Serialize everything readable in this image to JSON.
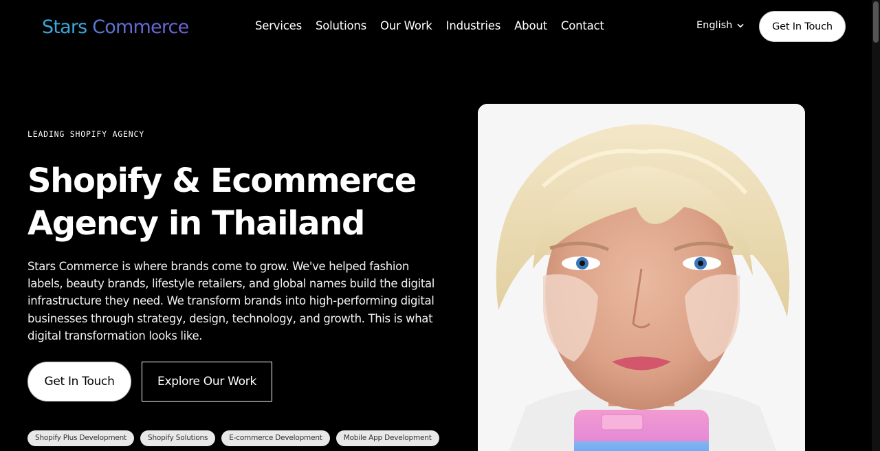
{
  "header": {
    "logo_part1": "Stars",
    "logo_part2": "Commerce",
    "nav": [
      "Services",
      "Solutions",
      "Our Work",
      "Industries",
      "About",
      "Contact"
    ],
    "language": "English",
    "cta": "Get In Touch"
  },
  "hero": {
    "eyebrow": "LEADING SHOPIFY AGENCY",
    "title_line1": "Shopify & Ecommerce",
    "title_line2": "Agency in Thailand",
    "description": "Stars Commerce is where brands come to grow. We've helped fashion labels, beauty brands, lifestyle retailers, and global names build the digital infrastructure they need. We transform brands into high-performing digital businesses through strategy, design, technology, and growth. This is what digital transformation looks like.",
    "primary_cta": "Get In Touch",
    "secondary_cta": "Explore Our Work",
    "tags": [
      "Shopify Plus Development",
      "Shopify Solutions",
      "E-commerce Development",
      "Mobile App Development"
    ]
  },
  "colors": {
    "background": "#000000",
    "logo_blue": "#3aa6d8",
    "logo_purple": "#6e5fd0"
  }
}
